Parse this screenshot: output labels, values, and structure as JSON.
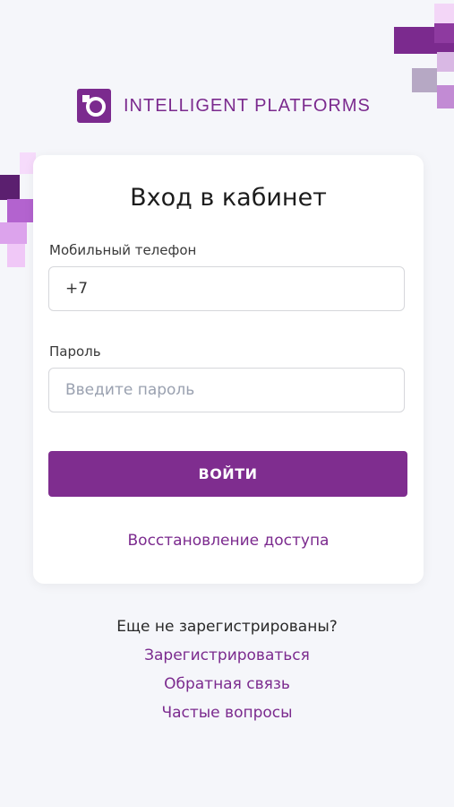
{
  "brand": {
    "name": "INTELLIGENT PLATFORMS",
    "logo_icon": "io-logo-icon",
    "accent_color": "#7b2a8e"
  },
  "login": {
    "title": "Вход в кабинет",
    "phone_label": "Мобильный телефон",
    "phone_value": "+7",
    "password_label": "Пароль",
    "password_placeholder": "Введите пароль",
    "submit_label": "ВОЙТИ",
    "recover_label": "Восстановление доступа"
  },
  "footer": {
    "question": "Еще не зарегистрированы?",
    "register_label": "Зарегистрироваться",
    "feedback_label": "Обратная связь",
    "faq_label": "Частые вопросы"
  }
}
